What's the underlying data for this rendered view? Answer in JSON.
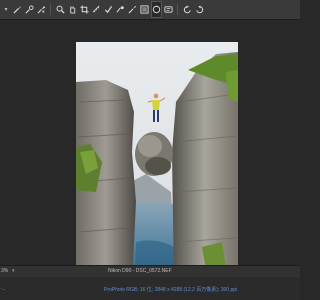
{
  "toolbar": {
    "tools": [
      {
        "name": "brush-tool-icon"
      },
      {
        "name": "brush-settings-icon"
      },
      {
        "name": "smudge-tool-icon"
      },
      {
        "name": "zoom-icon"
      },
      {
        "name": "hand-icon"
      },
      {
        "name": "crop-icon"
      },
      {
        "name": "straighten-icon"
      },
      {
        "name": "spot-removal-icon"
      },
      {
        "name": "red-eye-icon"
      },
      {
        "name": "graduated-filter-icon"
      },
      {
        "name": "radial-filter-icon"
      },
      {
        "name": "adjustment-brush-icon"
      },
      {
        "name": "rotate-left-icon"
      },
      {
        "name": "rotate-right-icon"
      }
    ]
  },
  "status": {
    "zoom": "3%",
    "filename": "Nikon D90 - DSC_0572.NEF"
  },
  "info": {
    "left": "·..",
    "workflow": "ProPhoto RGB; 16 位; 2848 x 4288 (12.2 百万像素); 300 ppi"
  }
}
